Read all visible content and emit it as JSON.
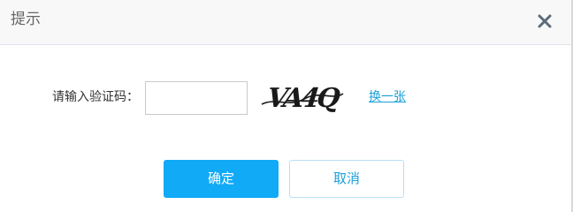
{
  "dialog": {
    "title": "提示",
    "close_icon": "close-icon"
  },
  "form": {
    "label": "请输入验证码：",
    "input_value": "",
    "input_placeholder": "",
    "captcha_text": "VA4Q",
    "refresh_label": "换一张"
  },
  "buttons": {
    "confirm_label": "确定",
    "cancel_label": "取消"
  },
  "colors": {
    "primary": "#11aaf6",
    "link": "#1a9fd8",
    "header_bg": "#f8f8f8",
    "close_icon": "#5c6b7a"
  }
}
